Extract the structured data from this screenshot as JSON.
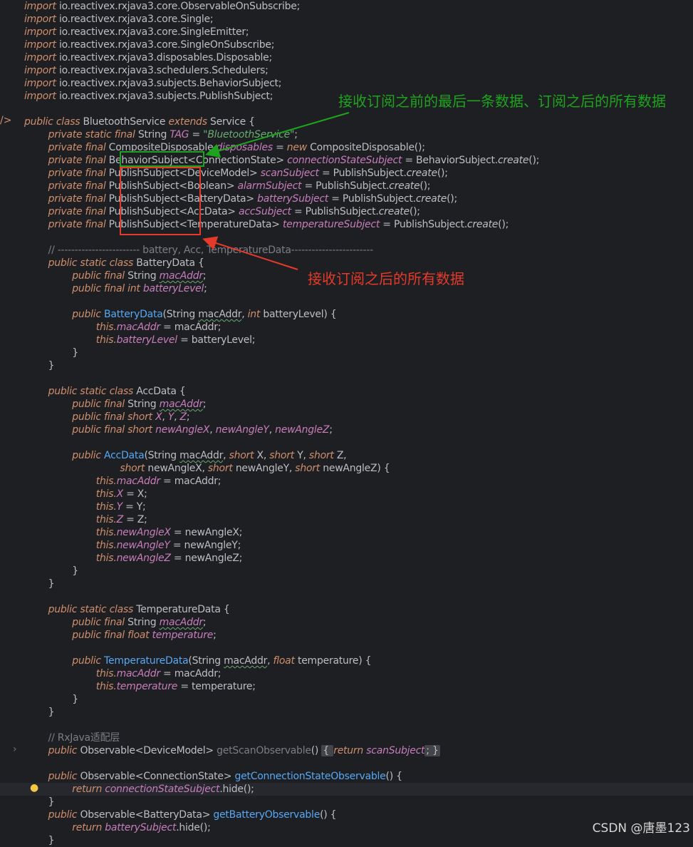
{
  "code": {
    "lines": [
      [
        [
          "import ",
          "kw"
        ],
        [
          "io.reactivex.rxjava3.core.",
          ""
        ],
        [
          "ObservableOnSubscribe;",
          ""
        ]
      ],
      [
        [
          "import ",
          "kw"
        ],
        [
          "io.reactivex.rxjava3.core.Single;",
          ""
        ]
      ],
      [
        [
          "import ",
          "kw"
        ],
        [
          "io.reactivex.rxjava3.core.SingleEmitter;",
          ""
        ]
      ],
      [
        [
          "import ",
          "kw"
        ],
        [
          "io.reactivex.rxjava3.core.SingleOnSubscribe;",
          ""
        ]
      ],
      [
        [
          "import ",
          "kw"
        ],
        [
          "io.reactivex.rxjava3.disposables.Disposable;",
          ""
        ]
      ],
      [
        [
          "import ",
          "kw"
        ],
        [
          "io.reactivex.rxjava3.schedulers.Schedulers;",
          ""
        ]
      ],
      [
        [
          "import ",
          "kw"
        ],
        [
          "io.reactivex.rxjava3.subjects.BehaviorSubject;",
          ""
        ]
      ],
      [
        [
          "import ",
          "kw"
        ],
        [
          "io.reactivex.rxjava3.subjects.PublishSubject;",
          ""
        ]
      ],
      [],
      [
        [
          "public class ",
          "kw"
        ],
        [
          "BluetoothService ",
          ""
        ],
        [
          "extends ",
          "kw"
        ],
        [
          "Service {",
          ""
        ]
      ],
      [
        [
          "        private static final ",
          "kw"
        ],
        [
          "String ",
          ""
        ],
        [
          "TAG",
          "fld"
        ],
        [
          " = ",
          ""
        ],
        [
          "\"BluetoothService\"",
          "str"
        ],
        [
          ";",
          ""
        ]
      ],
      [
        [
          "        private final ",
          "kw"
        ],
        [
          "CompositeDisposable ",
          ""
        ],
        [
          "disposables",
          "fld"
        ],
        [
          " = ",
          ""
        ],
        [
          "new ",
          "kw"
        ],
        [
          "CompositeDisposable();",
          ""
        ]
      ],
      [
        [
          "        private final ",
          "kw"
        ],
        [
          "BehaviorSubject<ConnectionState> ",
          ""
        ],
        [
          "connectionStateSubject",
          "fld"
        ],
        [
          " = BehaviorSubject.",
          ""
        ],
        [
          "create",
          "st"
        ],
        [
          "();",
          ""
        ]
      ],
      [
        [
          "        private final ",
          "kw"
        ],
        [
          "PublishSubject<DeviceModel> ",
          ""
        ],
        [
          "scanSubject",
          "fld"
        ],
        [
          " = PublishSubject.",
          ""
        ],
        [
          "create",
          "st"
        ],
        [
          "();",
          ""
        ]
      ],
      [
        [
          "        private final ",
          "kw"
        ],
        [
          "PublishSubject<Boolean> ",
          ""
        ],
        [
          "alarmSubject",
          "fld"
        ],
        [
          " = PublishSubject.",
          ""
        ],
        [
          "create",
          "st"
        ],
        [
          "();",
          ""
        ]
      ],
      [
        [
          "        private final ",
          "kw"
        ],
        [
          "PublishSubject<BatteryData> ",
          ""
        ],
        [
          "batterySubject",
          "fld"
        ],
        [
          " = PublishSubject.",
          ""
        ],
        [
          "create",
          "st"
        ],
        [
          "();",
          ""
        ]
      ],
      [
        [
          "        private final ",
          "kw"
        ],
        [
          "PublishSubject<AccData> ",
          ""
        ],
        [
          "accSubject",
          "fld"
        ],
        [
          " = PublishSubject.",
          ""
        ],
        [
          "create",
          "st"
        ],
        [
          "();",
          ""
        ]
      ],
      [
        [
          "        private final ",
          "kw"
        ],
        [
          "PublishSubject<TemperatureData> ",
          ""
        ],
        [
          "temperatureSubject",
          "fld"
        ],
        [
          " = PublishSubject.",
          ""
        ],
        [
          "create",
          "st"
        ],
        [
          "();",
          ""
        ]
      ],
      [],
      [
        [
          "        // ------------------------ battery, Acc, TemperatureData------------------------",
          "cm"
        ]
      ],
      [
        [
          "        public static class ",
          "kw"
        ],
        [
          "BatteryData {",
          ""
        ]
      ],
      [
        [
          "                public final ",
          "kw"
        ],
        [
          "String ",
          ""
        ],
        [
          "macAddr",
          "fld u"
        ],
        [
          ";",
          ""
        ]
      ],
      [
        [
          "                public final int ",
          "kw"
        ],
        [
          "batteryLevel",
          "fld"
        ],
        [
          ";",
          ""
        ]
      ],
      [],
      [
        [
          "                public ",
          "kw"
        ],
        [
          "BatteryData",
          "fn"
        ],
        [
          "(String ",
          ""
        ],
        [
          "macAddr",
          "u"
        ],
        [
          ", ",
          ""
        ],
        [
          "int ",
          "kw"
        ],
        [
          "batteryLevel) {",
          ""
        ]
      ],
      [
        [
          "                        this.",
          "kw"
        ],
        [
          "macAddr",
          "fld"
        ],
        [
          " = macAddr;",
          ""
        ]
      ],
      [
        [
          "                        this.",
          "kw"
        ],
        [
          "batteryLevel",
          "fld"
        ],
        [
          " = batteryLevel;",
          ""
        ]
      ],
      [
        [
          "                }",
          ""
        ]
      ],
      [
        [
          "        }",
          ""
        ]
      ],
      [],
      [
        [
          "        public static class ",
          "kw"
        ],
        [
          "AccData {",
          ""
        ]
      ],
      [
        [
          "                public final ",
          "kw"
        ],
        [
          "String ",
          ""
        ],
        [
          "macAddr",
          "fld u"
        ],
        [
          ";",
          ""
        ]
      ],
      [
        [
          "                public final short ",
          "kw"
        ],
        [
          "X",
          "fld"
        ],
        [
          ", ",
          ""
        ],
        [
          "Y",
          "fld"
        ],
        [
          ", ",
          ""
        ],
        [
          "Z",
          "fld"
        ],
        [
          ";",
          ""
        ]
      ],
      [
        [
          "                public final short ",
          "kw"
        ],
        [
          "newAngleX",
          "fld"
        ],
        [
          ", ",
          ""
        ],
        [
          "newAngleY",
          "fld"
        ],
        [
          ", ",
          ""
        ],
        [
          "newAngleZ",
          "fld"
        ],
        [
          ";",
          ""
        ]
      ],
      [],
      [
        [
          "                public ",
          "kw"
        ],
        [
          "AccData",
          "fn"
        ],
        [
          "(String ",
          ""
        ],
        [
          "macAddr",
          "u"
        ],
        [
          ", ",
          ""
        ],
        [
          "short ",
          "kw"
        ],
        [
          "X, ",
          ""
        ],
        [
          "short ",
          "kw"
        ],
        [
          "Y, ",
          ""
        ],
        [
          "short ",
          "kw"
        ],
        [
          "Z,",
          ""
        ]
      ],
      [
        [
          "                                ",
          "kw"
        ],
        [
          "short ",
          "kw"
        ],
        [
          "newAngleX, ",
          ""
        ],
        [
          "short ",
          "kw"
        ],
        [
          "newAngleY, ",
          ""
        ],
        [
          "short ",
          "kw"
        ],
        [
          "newAngleZ) {",
          ""
        ]
      ],
      [
        [
          "                        this.",
          "kw"
        ],
        [
          "macAddr",
          "fld"
        ],
        [
          " = macAddr;",
          ""
        ]
      ],
      [
        [
          "                        this.",
          "kw"
        ],
        [
          "X",
          "fld"
        ],
        [
          " = X;",
          ""
        ]
      ],
      [
        [
          "                        this.",
          "kw"
        ],
        [
          "Y",
          "fld"
        ],
        [
          " = Y;",
          ""
        ]
      ],
      [
        [
          "                        this.",
          "kw"
        ],
        [
          "Z",
          "fld"
        ],
        [
          " = Z;",
          ""
        ]
      ],
      [
        [
          "                        this.",
          "kw"
        ],
        [
          "newAngleX",
          "fld"
        ],
        [
          " = newAngleX;",
          ""
        ]
      ],
      [
        [
          "                        this.",
          "kw"
        ],
        [
          "newAngleY",
          "fld"
        ],
        [
          " = newAngleY;",
          ""
        ]
      ],
      [
        [
          "                        this.",
          "kw"
        ],
        [
          "newAngleZ",
          "fld"
        ],
        [
          " = newAngleZ;",
          ""
        ]
      ],
      [
        [
          "                }",
          ""
        ]
      ],
      [
        [
          "        }",
          ""
        ]
      ],
      [],
      [
        [
          "        public static class ",
          "kw"
        ],
        [
          "TemperatureData {",
          ""
        ]
      ],
      [
        [
          "                public final ",
          "kw"
        ],
        [
          "String ",
          ""
        ],
        [
          "macAddr",
          "fld u"
        ],
        [
          ";",
          ""
        ]
      ],
      [
        [
          "                public final float ",
          "kw"
        ],
        [
          "temperature",
          "fld"
        ],
        [
          ";",
          ""
        ]
      ],
      [],
      [
        [
          "                public ",
          "kw"
        ],
        [
          "TemperatureData",
          "fn"
        ],
        [
          "(String ",
          ""
        ],
        [
          "macAddr",
          "u"
        ],
        [
          ", ",
          ""
        ],
        [
          "float ",
          "kw"
        ],
        [
          "temperature) {",
          ""
        ]
      ],
      [
        [
          "                        this.",
          "kw"
        ],
        [
          "macAddr",
          "fld"
        ],
        [
          " = macAddr;",
          ""
        ]
      ],
      [
        [
          "                        this.",
          "kw"
        ],
        [
          "temperature",
          "fld"
        ],
        [
          " = temperature;",
          ""
        ]
      ],
      [
        [
          "                }",
          ""
        ]
      ],
      [
        [
          "        }",
          ""
        ]
      ],
      [],
      [
        [
          "        // RxJava适配层",
          "cm"
        ]
      ],
      [
        [
          "        public ",
          "kw"
        ],
        [
          "Observable<DeviceModel> ",
          ""
        ],
        [
          "getScanObservable",
          "cm"
        ],
        [
          "() ",
          ""
        ],
        [
          "{ ",
          "fold"
        ],
        [
          "return ",
          "kw"
        ],
        [
          "scanSubject",
          "fld"
        ],
        [
          "; }",
          "fold"
        ]
      ],
      [],
      [
        [
          "        public ",
          "kw"
        ],
        [
          "Observable<ConnectionState> ",
          ""
        ],
        [
          "getConnectionStateObservable",
          "fn"
        ],
        [
          "() {",
          ""
        ]
      ],
      [
        [
          "                return ",
          "kw"
        ],
        [
          "connectionStateSubject",
          "fld"
        ],
        [
          ".hide();",
          ""
        ]
      ],
      [
        [
          "        }",
          ""
        ]
      ],
      [
        [
          "        public ",
          "kw"
        ],
        [
          "Observable<BatteryData> ",
          ""
        ],
        [
          "getBatteryObservable",
          "fn"
        ],
        [
          "() {",
          ""
        ]
      ],
      [
        [
          "                return ",
          "kw"
        ],
        [
          "batterySubject",
          "fld"
        ],
        [
          ".hide();",
          ""
        ]
      ],
      [
        [
          "        }",
          ""
        ]
      ]
    ]
  },
  "annotations": {
    "green_text": "接收订阅之前的最后一条数据、订阅之后的所有数据",
    "red_text": "接收订阅之后的所有数据",
    "green_color": "#1fa31f",
    "red_color": "#e53a2a"
  },
  "watermark": "CSDN @唐墨123"
}
